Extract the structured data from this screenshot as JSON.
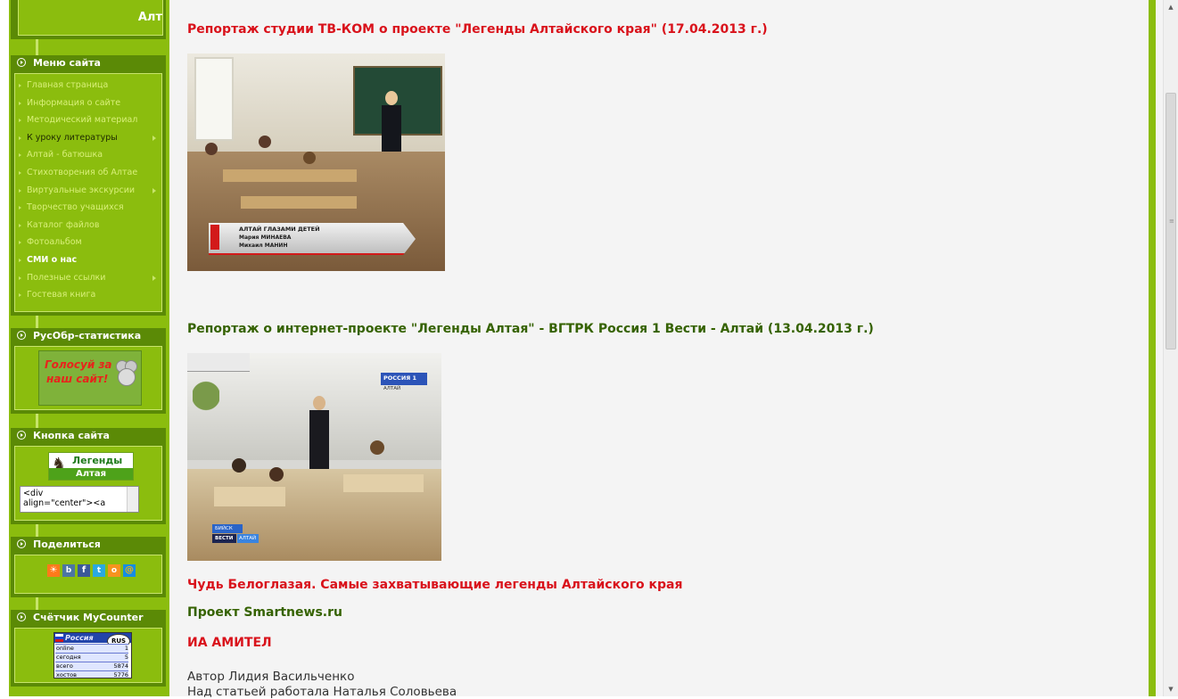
{
  "header": {
    "title_fragment": "Алт"
  },
  "menu": {
    "title": "Меню сайта",
    "items": [
      {
        "label": "Главная страница",
        "style": "light",
        "submenu": false
      },
      {
        "label": "Информация о сайте",
        "style": "light",
        "submenu": false
      },
      {
        "label": "Методический материал",
        "style": "light",
        "submenu": false
      },
      {
        "label": "К уроку литературы",
        "style": "dark",
        "submenu": true
      },
      {
        "label": "Алтай - батюшка",
        "style": "light",
        "submenu": false
      },
      {
        "label": "Стихотворения об Алтае",
        "style": "light",
        "submenu": false
      },
      {
        "label": "Виртуальные экскурсии",
        "style": "light",
        "submenu": true
      },
      {
        "label": "Творчество учащихся",
        "style": "light",
        "submenu": false
      },
      {
        "label": "Каталог файлов",
        "style": "light",
        "submenu": false
      },
      {
        "label": "Фотоальбом",
        "style": "light",
        "submenu": false
      },
      {
        "label": "СМИ о нас",
        "style": "active",
        "submenu": false
      },
      {
        "label": "Полезные ссылки",
        "style": "light",
        "submenu": true
      },
      {
        "label": "Гостевая книга",
        "style": "light",
        "submenu": false
      }
    ]
  },
  "rusobr": {
    "title": "РусОбр-статистика",
    "banner_text_line1": "Голосуй за",
    "banner_text_line2": "наш сайт!"
  },
  "site_button": {
    "title": "Кнопка сайта",
    "logo_line1": "Легенды",
    "logo_line2": "Алтая",
    "code_line1": "<div",
    "code_line2": "align=\"center\"><a"
  },
  "share": {
    "title": "Поделиться",
    "icons": [
      "b",
      "f",
      "t",
      "o",
      "@"
    ]
  },
  "counter": {
    "title": "Счётчик MyCounter",
    "header_text": "Россия",
    "badge": "RUS",
    "rows": [
      {
        "label": "online",
        "value": "1"
      },
      {
        "label": "сегодня",
        "value": "5"
      },
      {
        "label": "всего",
        "value": "5874"
      },
      {
        "label": "хостов",
        "value": "5776"
      }
    ]
  },
  "main": {
    "report1_title": "Репортаж студии ТВ-КОМ о проекте \"Легенды Алтайского края\" (17.04.2013 г.)",
    "image1_caption_line1": "АЛТАЙ ГЛАЗАМИ ДЕТЕЙ",
    "image1_caption_line2": "Мария МИНАЕВА",
    "image1_caption_line3": "Михаил МАНИН",
    "report2_title": "Репортаж о интернет-проекте \"Легенды Алтая\" - ВГТРК Россия 1 Вести - Алтай (13.04.2013 г.)",
    "image2_logo_line1": "РОССИЯ 1",
    "image2_logo_line2": "АЛТАЙ",
    "image2_tag_city": "БИЙСК",
    "image2_tag_vesti": "ВЕСТИ",
    "image2_tag_region": "АЛТАЙ",
    "link1": "Чудь Белоглазая. Самые захватывающие легенды Алтайского края",
    "link2": "Проект Smartnews.ru",
    "link3": "ИА АМИТЕЛ",
    "author": "Автор Лидия Васильченко",
    "editor": "Над статьей работала Наталья Соловьева"
  },
  "colors": {
    "sidebar": "#8bbd0e",
    "block_dark": "#5b8a06",
    "link_red": "#d9121b",
    "link_green": "#356200",
    "content_bg": "#f4f4f4"
  }
}
